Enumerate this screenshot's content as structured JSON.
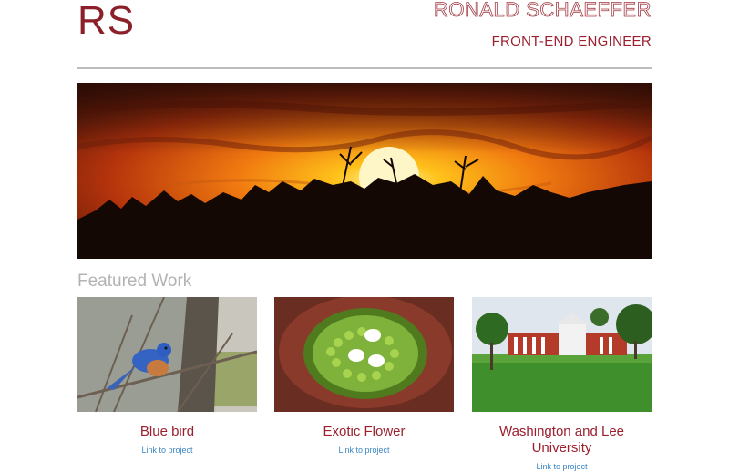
{
  "header": {
    "logo": "RS",
    "name": "RONALD SCHAEFFER",
    "role": "FRONT-END ENGINEER"
  },
  "hero": {
    "image": "sunset-over-treeline"
  },
  "featured": {
    "heading": "Featured Work",
    "items": [
      {
        "title": "Blue bird",
        "link": "Link to project",
        "image": "bluebird-on-branch"
      },
      {
        "title": "Exotic Flower",
        "link": "Link to project",
        "image": "exotic-flower"
      },
      {
        "title": "Washington and Lee University",
        "link": "Link to project",
        "image": "university-lawn"
      }
    ]
  },
  "colors": {
    "accent": "#9b1f2e",
    "link": "#3a86c4",
    "rule": "#bdbdbd"
  }
}
